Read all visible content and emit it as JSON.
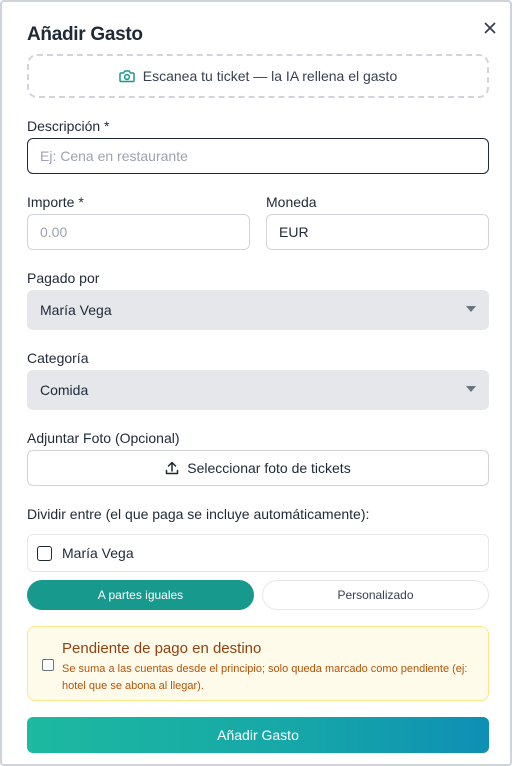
{
  "modal": {
    "title": "Añadir Gasto",
    "close_icon": "x-icon"
  },
  "scan": {
    "icon": "camera-icon",
    "label": "Escanea tu ticket — la IA rellena el gasto"
  },
  "description": {
    "label": "Descripción *",
    "placeholder": "Ej: Cena en restaurante",
    "value": ""
  },
  "amount": {
    "label": "Importe *",
    "placeholder": "0.00",
    "value": ""
  },
  "currency": {
    "label": "Moneda",
    "value": "EUR"
  },
  "paid_by": {
    "label": "Pagado por",
    "selected": "María Vega"
  },
  "category": {
    "label": "Categoría",
    "selected": "Comida"
  },
  "photo": {
    "label": "Adjuntar Foto (Opcional)",
    "button_label": "Seleccionar foto de tickets",
    "icon": "upload-icon"
  },
  "split": {
    "label": "Dividir entre (el que paga se incluye automáticamente):",
    "participants": [
      {
        "name": "María Vega",
        "checked": false
      }
    ],
    "modes": [
      {
        "label": "A partes iguales",
        "active": true
      },
      {
        "label": "Personalizado",
        "active": false
      }
    ]
  },
  "pending": {
    "title": "Pendiente de pago en destino",
    "description": "Se suma a las cuentas desde el principio; solo queda marcado como pendiente (ej: hotel que se abona al llegar).",
    "checked": false
  },
  "submit_label": "Añadir Gasto",
  "colors": {
    "accent": "#17998d",
    "gradient_start": "#1db9a0",
    "gradient_end": "#0e8fb5",
    "select_bg": "#e5e7eb",
    "pending_bg": "#fffbeb",
    "pending_title": "#92400e"
  }
}
